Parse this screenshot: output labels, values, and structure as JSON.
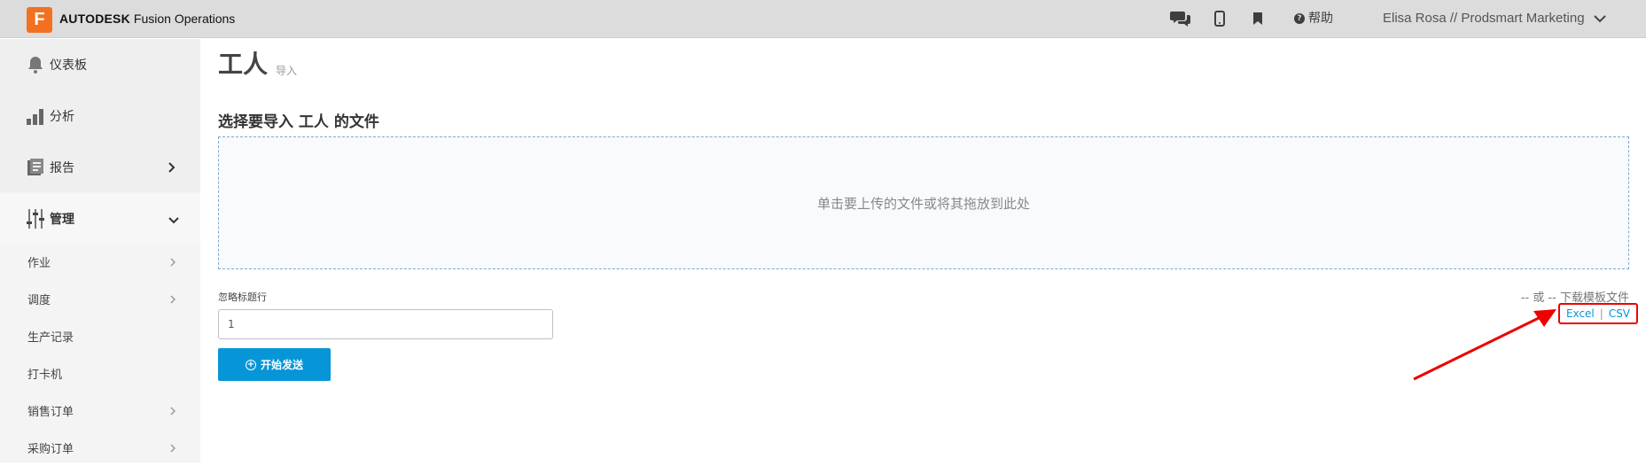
{
  "header": {
    "logo_letter": "F",
    "brand_bold": "AUTODESK",
    "brand_product": "Fusion Operations",
    "icons": [
      "chat-icon",
      "mobile-icon",
      "bookmark-icon"
    ],
    "help_label": "帮助",
    "user_label": "Elisa Rosa // Prodsmart Marketing"
  },
  "sidebar": {
    "items": [
      {
        "label": "仪表板",
        "icon": "bell-icon"
      },
      {
        "label": "分析",
        "icon": "bar-chart-icon"
      },
      {
        "label": "报告",
        "icon": "report-icon"
      },
      {
        "label": "管理",
        "icon": "sliders-icon"
      }
    ],
    "subitems": [
      {
        "label": "作业"
      },
      {
        "label": "调度"
      },
      {
        "label": "生产记录"
      },
      {
        "label": "打卡机"
      },
      {
        "label": "销售订单"
      },
      {
        "label": "采购订单"
      }
    ]
  },
  "main": {
    "title": "工人",
    "subtitle": "导入",
    "section_title": "选择要导入 工人 的文件",
    "dropzone_text": "单击要上传的文件或将其拖放到此处",
    "ignore_label": "忽略标题行",
    "ignore_value": "1",
    "start_button": "开始发送",
    "or_text": "-- 或 -- 下载模板文件",
    "excel_link": "Excel",
    "csv_link": "CSV",
    "link_separator": "|"
  },
  "colors": {
    "accent": "#0696d7",
    "logo": "#f37021",
    "highlight": "#e00000"
  }
}
